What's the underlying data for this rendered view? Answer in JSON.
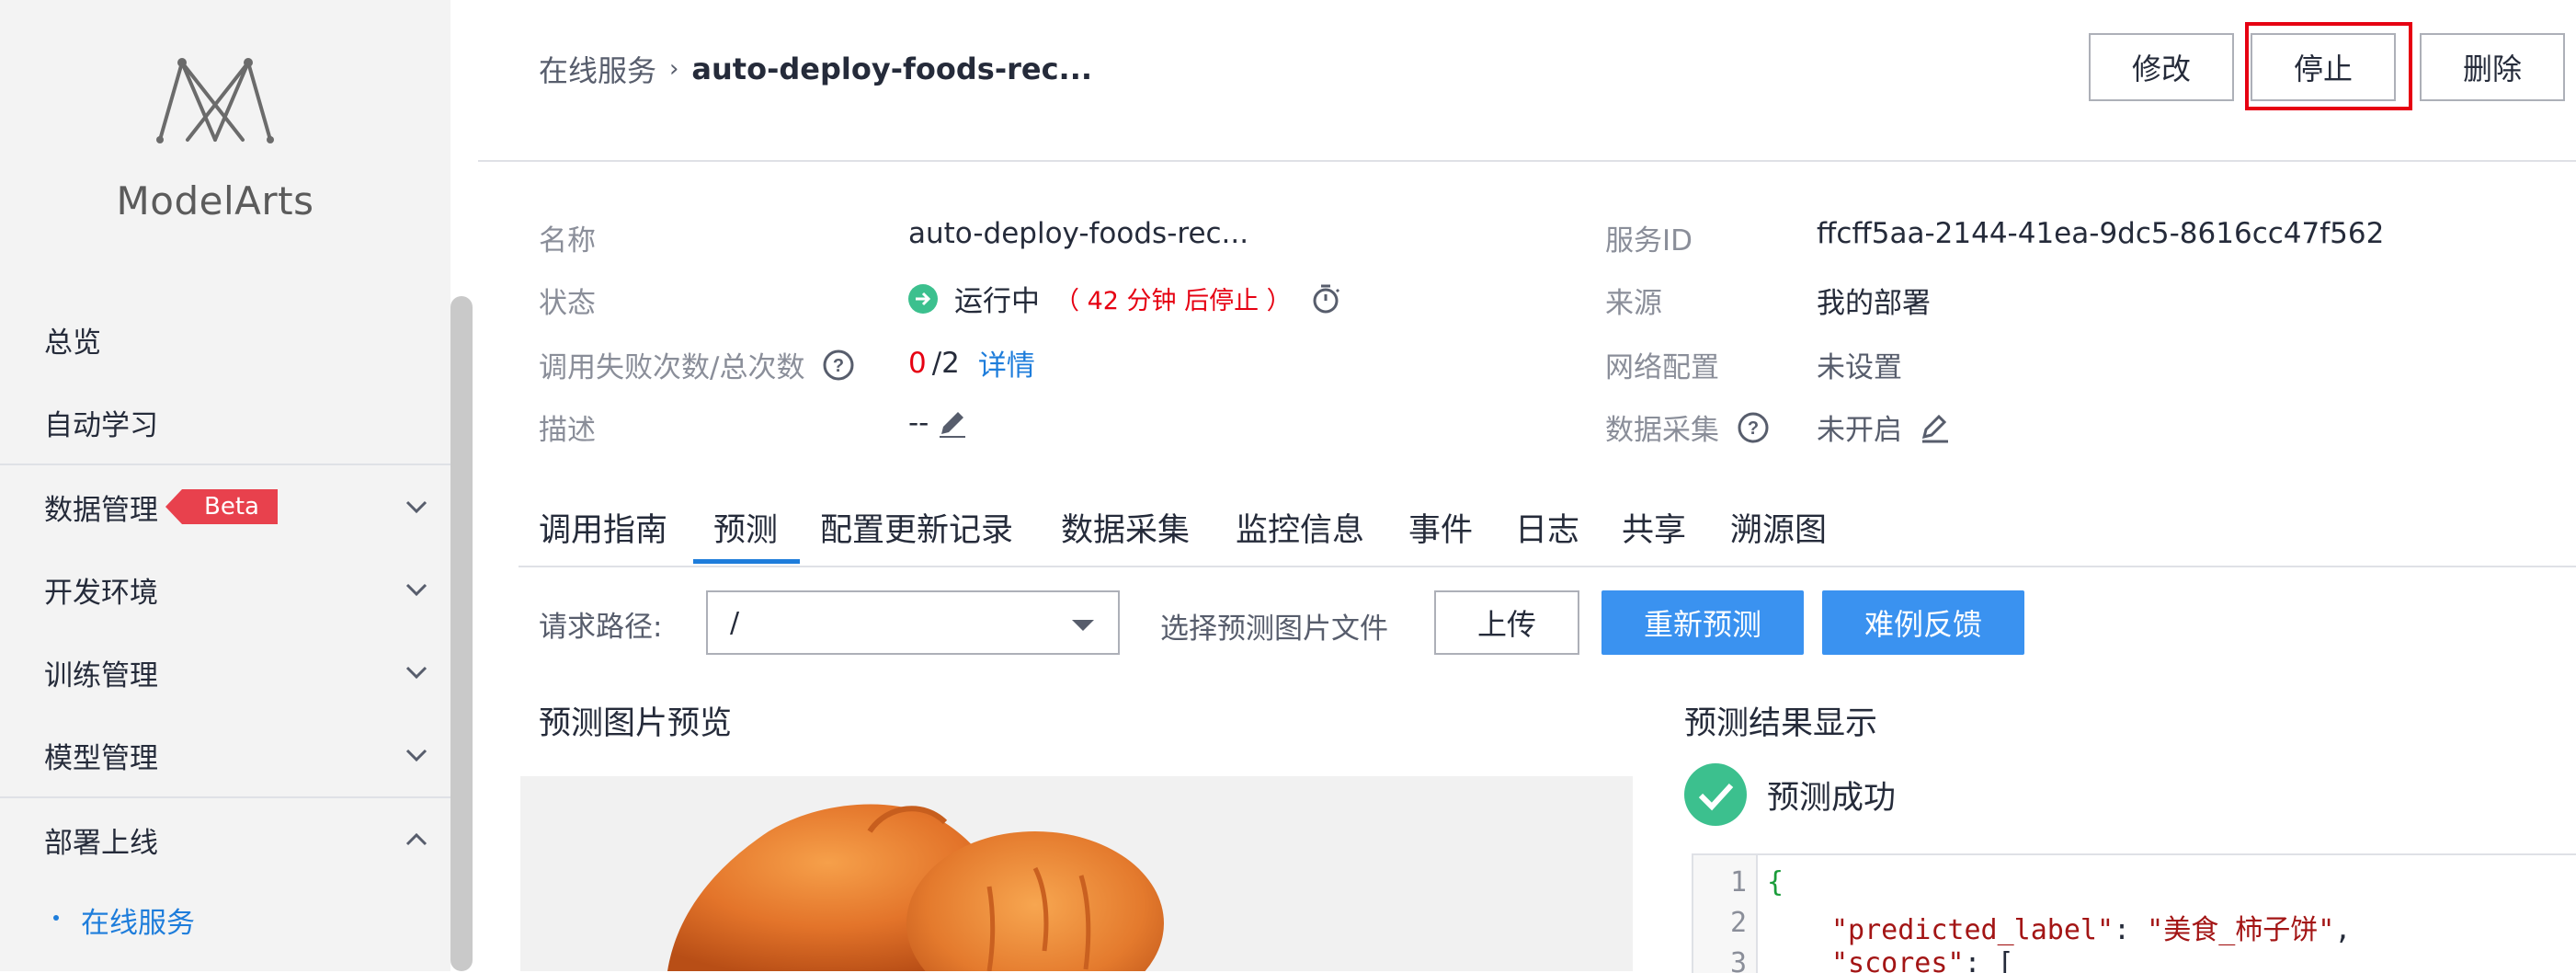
{
  "sidebar": {
    "brand": "ModelArts",
    "items": [
      {
        "label": "总览"
      },
      {
        "label": "自动学习"
      },
      {
        "label": "数据管理",
        "badge": "Beta"
      },
      {
        "label": "开发环境"
      },
      {
        "label": "训练管理"
      },
      {
        "label": "模型管理"
      },
      {
        "label": "部署上线"
      }
    ],
    "sub_item": "在线服务",
    "colors": {
      "active": "#1e7ddb",
      "badge": "#e8414d"
    }
  },
  "breadcrumb": {
    "parent": "在线服务",
    "current": "auto-deploy-foods-rec..."
  },
  "actions": {
    "edit": "修改",
    "stop": "停止",
    "delete": "删除",
    "highlight_color": "#e60012"
  },
  "info": {
    "name_label": "名称",
    "name_value": "auto-deploy-foods-rec...",
    "status_label": "状态",
    "status_value": "运行中",
    "status_note": "（ 42 分钟 后停止 ）",
    "calls_label": "调用失败次数/总次数",
    "calls_failed": "0",
    "calls_total": "/2",
    "calls_detail": "详情",
    "desc_label": "描述",
    "desc_value": "--",
    "service_id_label": "服务ID",
    "service_id_value": "ffcff5aa-2144-41ea-9dc5-8616cc47f562",
    "source_label": "来源",
    "source_value": "我的部署",
    "network_label": "网络配置",
    "network_value": "未设置",
    "collect_label": "数据采集",
    "collect_value": "未开启"
  },
  "tabs": [
    {
      "label": "调用指南"
    },
    {
      "label": "预测",
      "active": true
    },
    {
      "label": "配置更新记录"
    },
    {
      "label": "数据采集"
    },
    {
      "label": "监控信息"
    },
    {
      "label": "事件"
    },
    {
      "label": "日志"
    },
    {
      "label": "共享"
    },
    {
      "label": "溯源图"
    }
  ],
  "request": {
    "path_label": "请求路径:",
    "path_value": "/",
    "file_label": "选择预测图片文件",
    "upload": "上传",
    "repredict": "重新预测",
    "feedback": "难例反馈"
  },
  "preview": {
    "title": "预测图片预览"
  },
  "result": {
    "title": "预测结果显示",
    "status": "预测成功",
    "lines": [
      {
        "num": "1",
        "text": "{"
      },
      {
        "num": "2",
        "key": "\"predicted_label\"",
        "colon": ": ",
        "value": "\"美食_柿子饼\"",
        "tail": ","
      },
      {
        "num": "3",
        "key": "\"scores\"",
        "colon": ": ",
        "value": "[",
        "tail": ""
      }
    ]
  }
}
